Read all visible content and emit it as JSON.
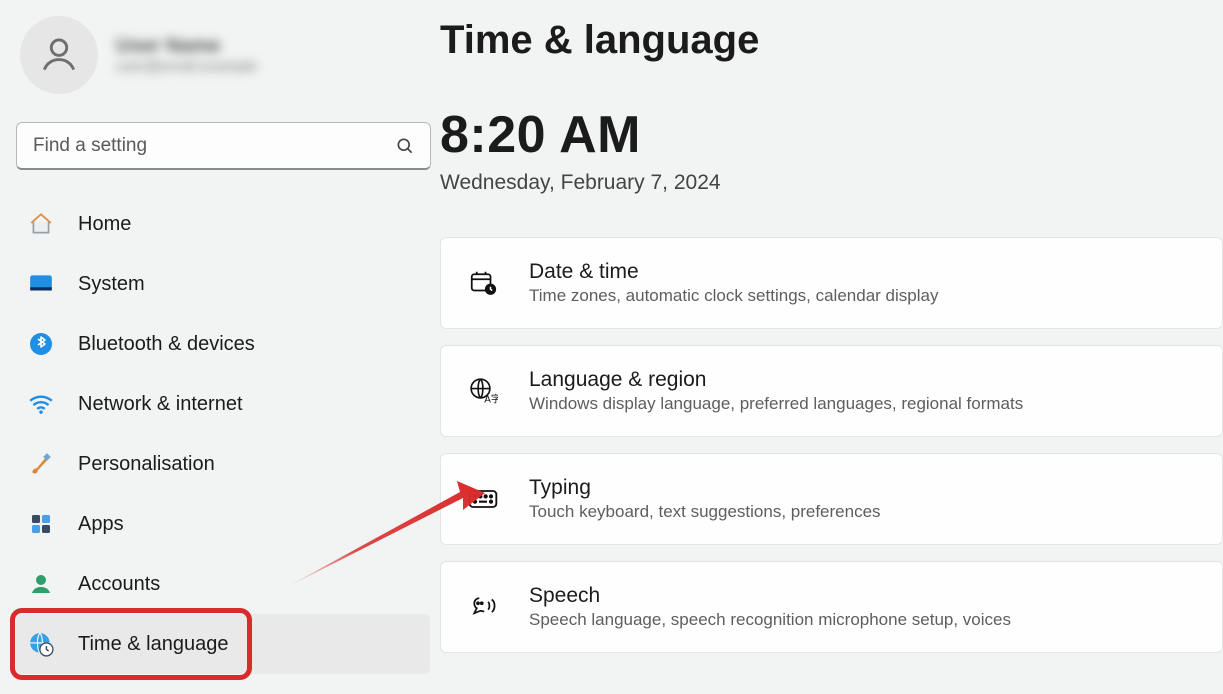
{
  "profile": {
    "name": "User Name",
    "sub": "user@email.example"
  },
  "search": {
    "placeholder": "Find a setting"
  },
  "nav": {
    "home": "Home",
    "system": "System",
    "bluetooth": "Bluetooth & devices",
    "network": "Network & internet",
    "personalisation": "Personalisation",
    "apps": "Apps",
    "accounts": "Accounts",
    "time_language": "Time & language"
  },
  "page": {
    "title": "Time & language",
    "clock_time": "8:20 AM",
    "clock_date": "Wednesday, February 7, 2024"
  },
  "cards": {
    "date_time": {
      "title": "Date & time",
      "sub": "Time zones, automatic clock settings, calendar display"
    },
    "language_region": {
      "title": "Language & region",
      "sub": "Windows display language, preferred languages, regional formats"
    },
    "typing": {
      "title": "Typing",
      "sub": "Touch keyboard, text suggestions, preferences"
    },
    "speech": {
      "title": "Speech",
      "sub": "Speech language, speech recognition microphone setup, voices"
    }
  }
}
